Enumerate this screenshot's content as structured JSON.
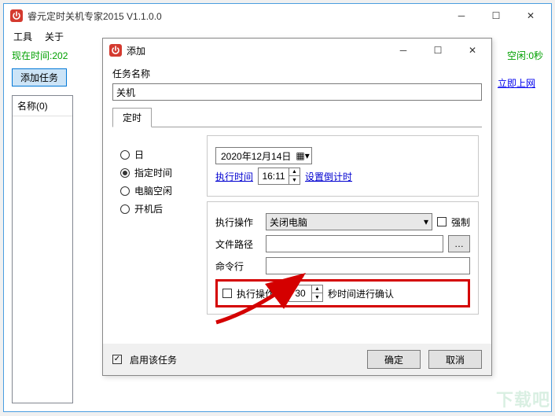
{
  "main": {
    "title": "睿元定时关机专家2015 V1.1.0.0",
    "menu": {
      "tools": "工具",
      "about": "关于"
    },
    "status": {
      "now_prefix": "现在时间:",
      "now_partial": "202",
      "idle": "空闲:0秒"
    },
    "add_task_btn": "添加任务",
    "list_header": "名称(0)",
    "link_online": "立即上网"
  },
  "dialog": {
    "title": "添加",
    "task_name_label": "任务名称",
    "task_name_value": "关机",
    "tab_timer": "定时",
    "radios": {
      "day": "日",
      "fixed_time": "指定时间",
      "idle": "电脑空闲",
      "after_boot": "开机后"
    },
    "selected_radio": "fixed_time",
    "date_value": "2020年12月14日",
    "exec_time_label": "执行时间",
    "exec_time_value": "16:11",
    "set_countdown": "设置倒计时",
    "action": {
      "exec_action_label": "执行操作",
      "exec_action_value": "关闭电脑",
      "force_label": "强制",
      "file_path_label": "文件路径",
      "cmd_label": "命令行"
    },
    "confirm": {
      "prefix": "执行操作前",
      "seconds": "30",
      "suffix": "秒时间进行确认"
    },
    "enable_task": "启用该任务",
    "ok": "确定",
    "cancel": "取消"
  },
  "watermark": "下载吧"
}
